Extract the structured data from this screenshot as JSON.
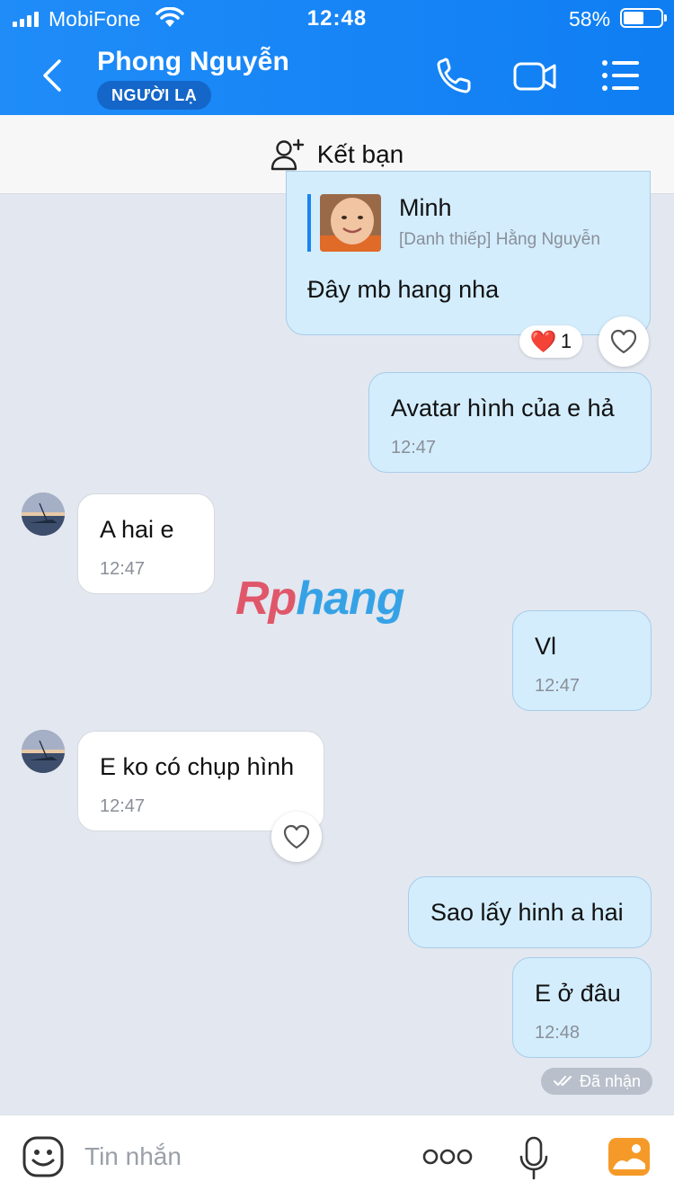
{
  "status_bar": {
    "carrier": "MobiFone",
    "time": "12:48",
    "battery": "58%"
  },
  "header": {
    "title": "Phong Nguyễn",
    "badge": "NGƯỜI LẠ"
  },
  "add_friend": {
    "label": "Kết bạn"
  },
  "messages": [
    {
      "id": "m1",
      "from": "me",
      "card_name": "Minh",
      "card_sub": "[Danh thiếp] Hằng Nguyễn",
      "text": "Đây mb hang nha",
      "reaction": {
        "emoji": "❤️",
        "count": "1"
      }
    },
    {
      "id": "m2",
      "from": "me",
      "text": "Avatar hình của e hả",
      "time": "12:47"
    },
    {
      "id": "m3",
      "from": "them",
      "text": "A hai e",
      "time": "12:47"
    },
    {
      "id": "m4",
      "from": "me",
      "text": "Vl",
      "time": "12:47"
    },
    {
      "id": "m5",
      "from": "them",
      "text": "E ko có chụp hình",
      "time": "12:47"
    },
    {
      "id": "m6",
      "from": "me",
      "text": "Sao lấy hinh a hai"
    },
    {
      "id": "m7",
      "from": "me",
      "text": "E ở đâu",
      "time": "12:48",
      "status": "Đã nhận"
    }
  ],
  "watermark": {
    "part1": "Rp",
    "part2": "hang"
  },
  "input": {
    "placeholder": "Tin nhắn"
  },
  "colors": {
    "header": "#0f7ef3",
    "my_bubble": "#d3edfd",
    "their_bubble": "#ffffff",
    "background": "#e3e7ef",
    "reaction_heart": "#e8303a"
  },
  "icons": [
    "back-icon",
    "phone-icon",
    "video-call-icon",
    "menu-list-icon",
    "add-user-icon",
    "heart-icon",
    "double-check-icon",
    "emoji-sticker-icon",
    "more-icon",
    "microphone-icon",
    "image-gallery-icon"
  ]
}
